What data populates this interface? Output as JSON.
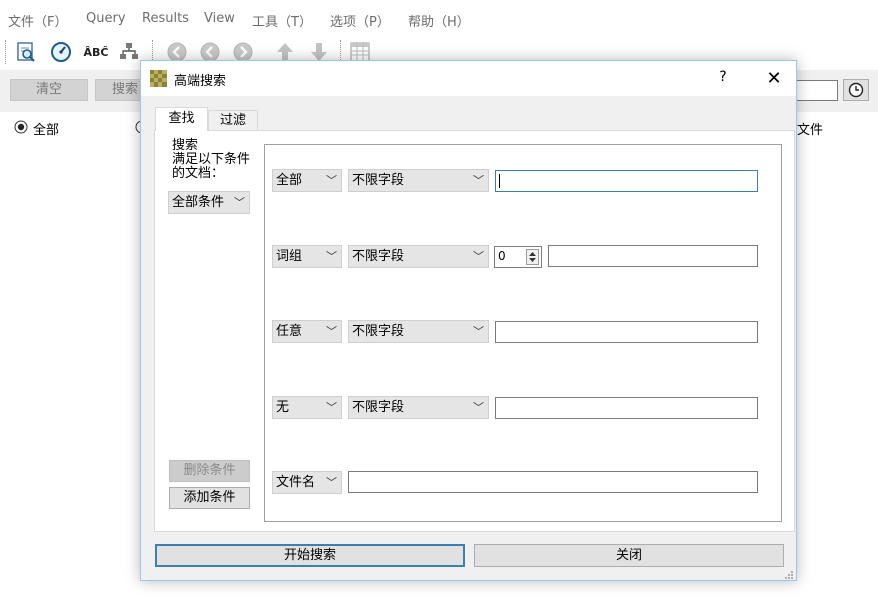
{
  "menubar": {
    "items": [
      "文件（F）",
      "Query",
      "Results",
      "View",
      "工具（T）",
      "选项（P）",
      "帮助（H）"
    ]
  },
  "toolbar": {
    "icons": [
      "search-doc-icon",
      "gauge-icon",
      "spellcheck-icon",
      "network-icon",
      "back-icon",
      "back-alt-icon",
      "forward-icon",
      "up-arrow-icon",
      "down-arrow-icon",
      "table-icon"
    ],
    "spellcheck_text": "ÂBĈ"
  },
  "app": {
    "clear_label": "清空",
    "search_label": "搜索",
    "radio_all_label": "全部",
    "files_label": "文件"
  },
  "dialog": {
    "title": "高端搜索",
    "help": "?",
    "close": "✕",
    "tabs": [
      "查找",
      "过滤"
    ],
    "left_label_lines": [
      "搜索",
      "满足以下条件",
      "的文档："
    ],
    "condition_combo": "全部条件",
    "delete_button": "删除条件",
    "add_button": "添加条件",
    "rows": [
      {
        "mode": "全部",
        "field": "不限字段",
        "value": ""
      },
      {
        "mode": "词组",
        "field": "不限字段",
        "distance": "0",
        "value": ""
      },
      {
        "mode": "任意",
        "field": "不限字段",
        "value": ""
      },
      {
        "mode": "无",
        "field": "不限字段",
        "value": ""
      },
      {
        "mode": "文件名",
        "value": ""
      }
    ],
    "start_button": "开始搜索",
    "close_button": "关闭"
  },
  "colors": {
    "accent_border": "#3c7fb1",
    "dialog_border": "#9ac6e8",
    "background": "#f0f0f0"
  }
}
